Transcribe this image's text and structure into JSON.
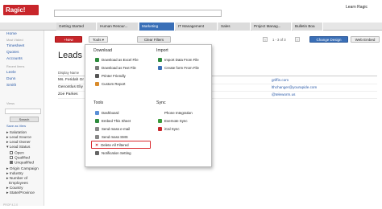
{
  "app": {
    "logo": "Ragic!",
    "learn_link": "Learn Ragic"
  },
  "tabs": [
    {
      "label": "Getting Started"
    },
    {
      "label": "Human Resour..."
    },
    {
      "label": "Marketing"
    },
    {
      "label": "IT Management"
    },
    {
      "label": "Sales"
    },
    {
      "label": "Project Manag..."
    },
    {
      "label": "Bulletin Boa"
    }
  ],
  "sidebar": {
    "links_top": [
      "Home"
    ],
    "most_visited_header": "Most Visited",
    "most_visited": [
      "Timesheet",
      "Quotes",
      "Accounts"
    ],
    "recent_header": "Recent Items",
    "recent": [
      "Leele",
      "Dunn",
      "Smith"
    ],
    "views_header": "Views",
    "search_label": "Search",
    "save_view": "Save as View",
    "filters": [
      "Salutation",
      "Lead Source",
      "Lead Owner",
      "Lead Status"
    ],
    "status_options": [
      {
        "label": "Open",
        "checked": false
      },
      {
        "label": "Qualified",
        "checked": false
      },
      {
        "label": "Unqualified",
        "checked": true
      }
    ],
    "filters2": [
      "Origin Campaign",
      "Industry",
      "Number of",
      "Employees",
      "Country",
      "State/Province"
    ]
  },
  "toolbar": {
    "new_label": "+New",
    "tools_label": "Tools ▾",
    "clear_filters": "Clear Filters",
    "pager": "1 - 3 of 3",
    "change_design": "Change Design",
    "web_embed": "Web Embed"
  },
  "main": {
    "title": "Leads Q",
    "column_header": "Display Name",
    "rows": [
      {
        "name": "Ms. Feridah Gr",
        "email": "griffin.com"
      },
      {
        "name": "Genontlus Eliy",
        "email": "lthchanger@yourapide.com"
      },
      {
        "name": "Zoe Parkes",
        "email": "@teleworm.us"
      }
    ]
  },
  "menu": {
    "download_header": "Download",
    "import_header": "Import",
    "download_items": [
      "Download as Excel File",
      "Download as Text File",
      "Printer Friendly",
      "Custom Report"
    ],
    "import_items": [
      "Import Data From File",
      "Create form From File"
    ],
    "tools_header": "Tools",
    "sync_header": "Sync",
    "tools_items": [
      "Dashboard",
      "Embed This Sheet",
      "Send mass e-mail",
      "Send mass SMS",
      "Delete All Filtered",
      "Notification Setting"
    ],
    "sync_items": [
      "Phone Integration",
      "Evernote Sync",
      "iCal Sync"
    ]
  },
  "footer": "PROP 4.2.0",
  "colors": {
    "brand_red": "#c8262b",
    "accent_blue": "#3a6fb7"
  }
}
